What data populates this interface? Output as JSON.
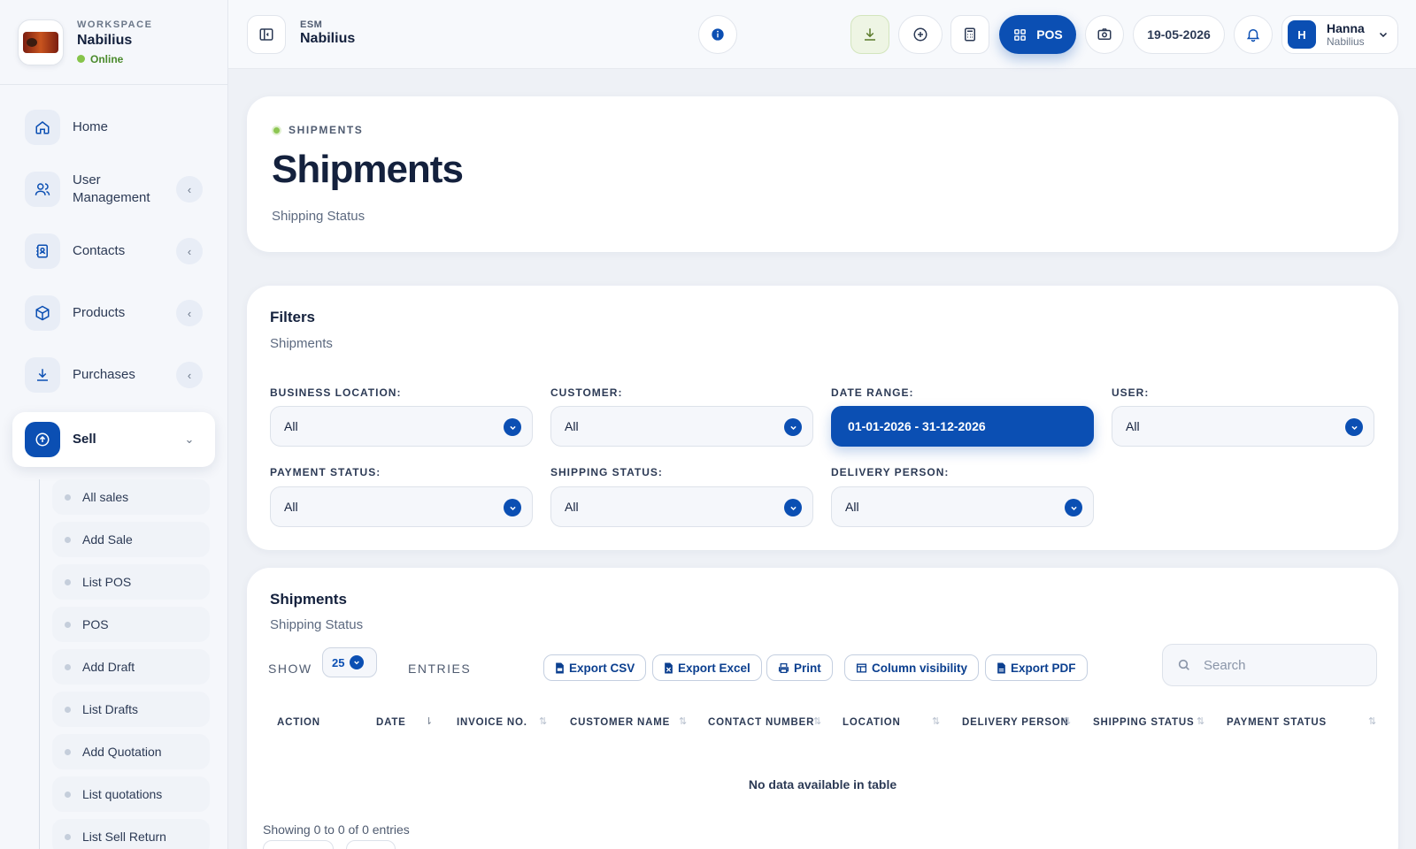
{
  "workspace": {
    "label": "WORKSPACE",
    "name": "Nabilius",
    "status": "Online"
  },
  "sidebar": {
    "items": [
      {
        "label": "Home",
        "icon": "home-icon",
        "has_chevron": false
      },
      {
        "label": "User Management",
        "icon": "users-icon",
        "has_chevron": true
      },
      {
        "label": "Contacts",
        "icon": "contacts-icon",
        "has_chevron": true
      },
      {
        "label": "Products",
        "icon": "box-icon",
        "has_chevron": true
      },
      {
        "label": "Purchases",
        "icon": "download-icon",
        "has_chevron": true
      },
      {
        "label": "Sell",
        "icon": "upload-icon",
        "has_chevron": true,
        "active": true
      }
    ],
    "sub_items": [
      "All sales",
      "Add Sale",
      "List POS",
      "POS",
      "Add Draft",
      "List Drafts",
      "Add Quotation",
      "List quotations",
      "List Sell Return"
    ]
  },
  "topbar": {
    "subtitle": "ESM",
    "title": "Nabilius",
    "pos_label": "POS",
    "date": "19-05-2026",
    "user": {
      "initial": "H",
      "name": "Hanna",
      "workspace": "Nabilius"
    }
  },
  "header": {
    "badge": "SHIPMENTS",
    "title": "Shipments",
    "subtitle": "Shipping Status"
  },
  "filters": {
    "title": "Filters",
    "subtitle": "Shipments",
    "fields": [
      {
        "label": "BUSINESS LOCATION:",
        "value": "All"
      },
      {
        "label": "CUSTOMER:",
        "value": "All"
      },
      {
        "label": "DATE RANGE:",
        "value": "01-01-2026 - 31-12-2026"
      },
      {
        "label": "USER:",
        "value": "All"
      },
      {
        "label": "PAYMENT STATUS:",
        "value": "All"
      },
      {
        "label": "SHIPPING STATUS:",
        "value": "All"
      },
      {
        "label": "DELIVERY PERSON:",
        "value": "All"
      }
    ]
  },
  "table": {
    "title": "Shipments",
    "subtitle": "Shipping Status",
    "show_label": "SHOW",
    "entries_value": "25",
    "entries_label": "ENTRIES",
    "buttons": [
      "Export CSV",
      "Export Excel",
      "Print",
      "Column visibility",
      "Export PDF"
    ],
    "search_placeholder": "Search",
    "columns": [
      "ACTION",
      "DATE",
      "INVOICE NO.",
      "CUSTOMER NAME",
      "CONTACT NUMBER",
      "LOCATION",
      "DELIVERY PERSON",
      "SHIPPING STATUS",
      "PAYMENT STATUS"
    ],
    "empty_text": "No data available in table",
    "info": "Showing 0 to 0 of 0 entries"
  },
  "colors": {
    "accent": "#0b4fb3",
    "online": "#86c44a"
  }
}
